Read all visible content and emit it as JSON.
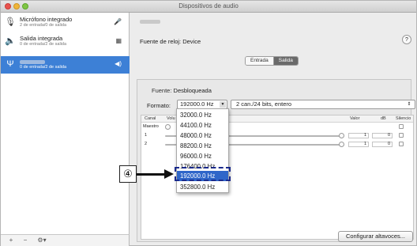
{
  "window": {
    "title": "Dispositivos de audio"
  },
  "sidebar": {
    "devices": [
      {
        "name": "Micrófono integrado",
        "sub": "2 de entrada/0 de salida",
        "icon": "microphone-icon",
        "badge": "mic-badge-icon"
      },
      {
        "name": "Salida integrada",
        "sub": "0 de entrada/2 de salida",
        "icon": "speaker-icon",
        "badge": "output-badge-icon"
      },
      {
        "name": "",
        "sub": "0 de entrada/2 de salida",
        "icon": "usb-icon",
        "badge": "speaker-badge-icon"
      }
    ],
    "footer": {
      "add": "+",
      "remove": "−",
      "gear": "⚙▾"
    }
  },
  "device_panel": {
    "clock_label": "Fuente de reloj: Device",
    "help": "?",
    "tabs": [
      {
        "label": "Entrada"
      },
      {
        "label": "Salida",
        "selected": true
      }
    ]
  },
  "format": {
    "fuente_label": "Fuente:",
    "fuente_value": "Desbloqueada",
    "formato_label": "Formato:",
    "selected_rate": "192000.0 Hz",
    "channels": "2 can./24 bits, entero",
    "options": [
      "32000.0 Hz",
      "44100.0 Hz",
      "48000.0 Hz",
      "88200.0 Hz",
      "96000.0 Hz",
      "176400.0 Hz",
      "192000.0 Hz",
      "352800.0 Hz"
    ],
    "highlighted_index": 6
  },
  "table": {
    "headers": {
      "canal": "Canal",
      "volumen": "Volu",
      "valor": "Valor",
      "db": "dB",
      "silencio": "Silencio"
    },
    "rows": [
      {
        "canal": "Maestro",
        "valor": "",
        "db": ""
      },
      {
        "canal": "1",
        "valor": "1",
        "db": "0"
      },
      {
        "canal": "2",
        "valor": "1",
        "db": "0"
      }
    ]
  },
  "buttons": {
    "configure": "Configurar altavoces..."
  },
  "callout": {
    "number": "④"
  },
  "colors": {
    "selection": "#3d80d6",
    "menu_highlight": "#2f66c9",
    "annotation": "#1a2a8c"
  }
}
